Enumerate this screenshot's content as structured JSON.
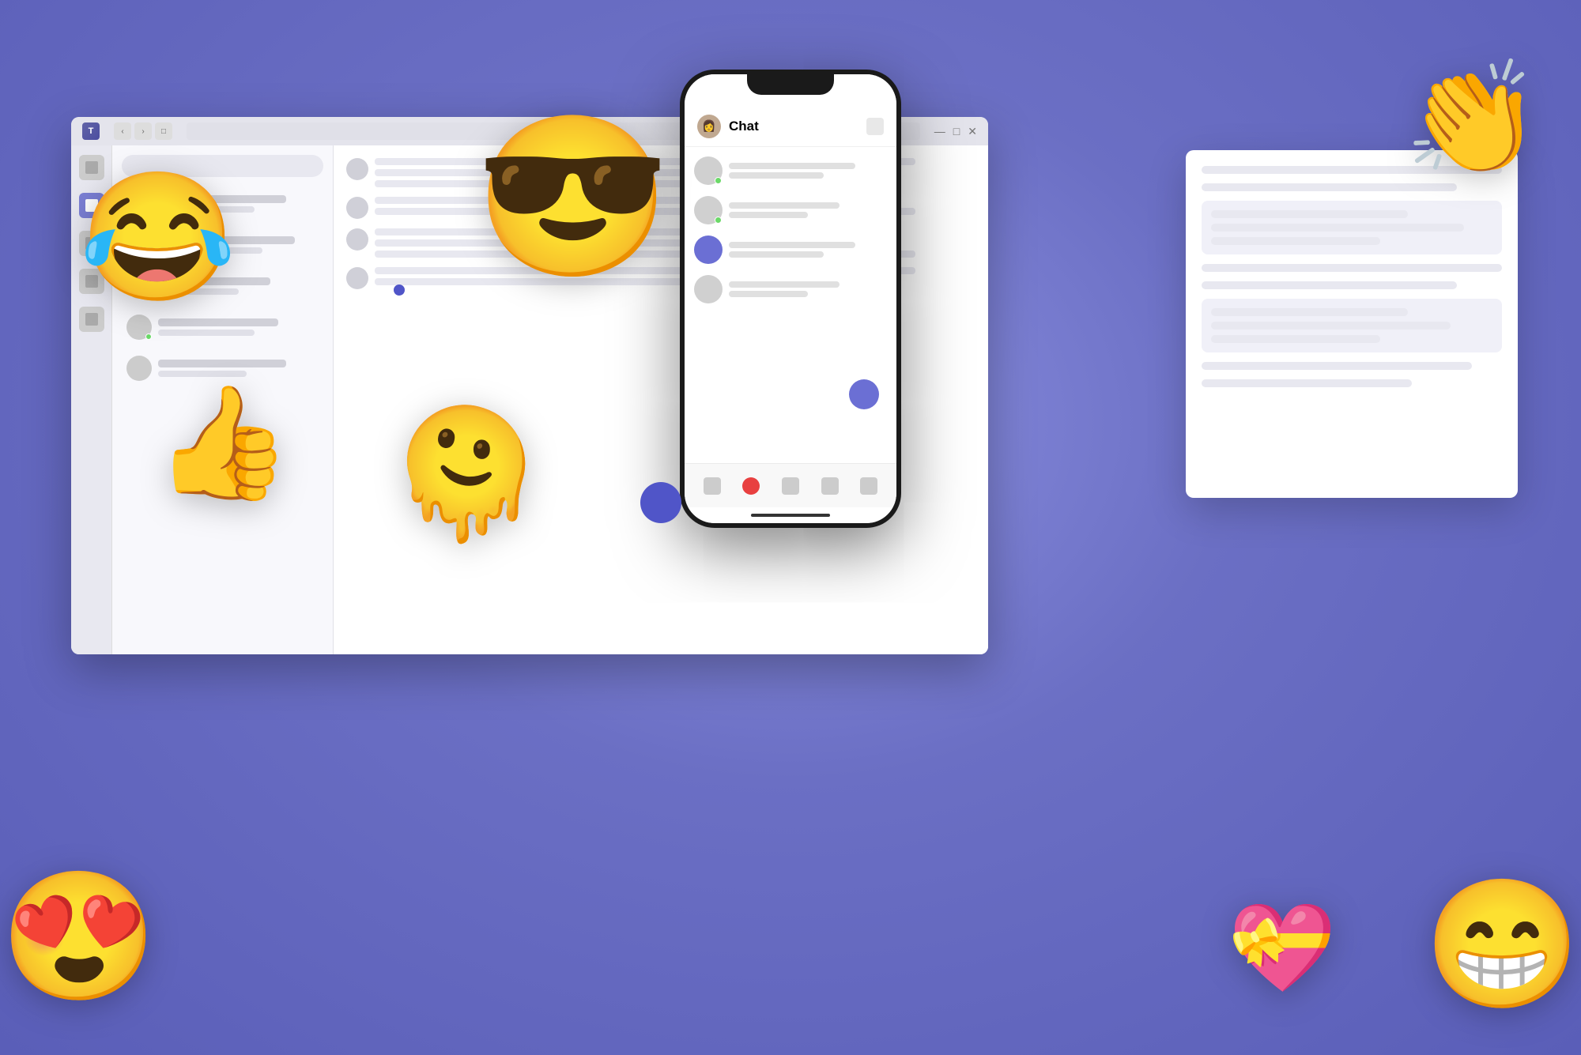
{
  "background": {
    "color": "#7B7FD4"
  },
  "desktop_window": {
    "titlebar": {
      "app_name": "Microsoft Teams",
      "app_icon": "T"
    },
    "sidebar_icons": [
      "chat",
      "teams",
      "calendar",
      "calls",
      "files"
    ],
    "chat_items": [
      {
        "has_online": true,
        "line1_width": "75%",
        "line2_width": "55%"
      },
      {
        "has_online": true,
        "line1_width": "80%",
        "line2_width": "60%"
      },
      {
        "has_online": false,
        "line1_width": "70%",
        "line2_width": "50%"
      },
      {
        "has_online": true,
        "line1_width": "85%",
        "line2_width": "65%"
      }
    ],
    "content_rows": [
      {
        "lines": [
          "long",
          "medium",
          "short"
        ]
      },
      {
        "lines": [
          "medium",
          "long"
        ]
      },
      {
        "lines": [
          "short",
          "medium",
          "long"
        ]
      }
    ]
  },
  "secondary_card": {
    "lines": [
      "w100",
      "w85",
      "w70",
      "w60",
      "w90",
      "w70",
      "w85",
      "w60"
    ]
  },
  "phone": {
    "header": {
      "title": "Chat",
      "avatar_emoji": "👩"
    },
    "chat_items": [
      {
        "type": "gray",
        "has_dot": true
      },
      {
        "type": "gray",
        "has_dot": true
      },
      {
        "type": "purple",
        "has_dot": false
      },
      {
        "type": "gray",
        "has_dot": false
      }
    ],
    "tabs": [
      "messages",
      "notifications",
      "chat-active",
      "teams",
      "more"
    ],
    "fab_color": "#6B6FD4"
  },
  "emojis": {
    "laugh_crying": "😂",
    "cool_sunglasses": "😎",
    "clapping_hands": "👏",
    "thumbs_up": "👍",
    "melting_face": "🫠",
    "heart_gift": "💝",
    "love_eyes": "😍",
    "grinning": "😁"
  }
}
